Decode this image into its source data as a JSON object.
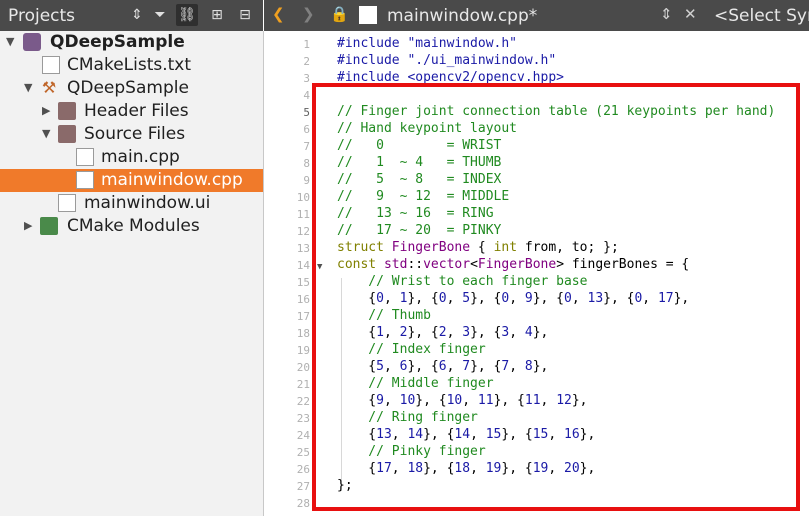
{
  "projects_panel": {
    "title": "Projects",
    "tree": [
      {
        "label": "QDeepSample",
        "icon": "project-icon",
        "bold": true
      },
      {
        "label": "CMakeLists.txt",
        "icon": "cmake-file-icon"
      },
      {
        "label": "QDeepSample",
        "icon": "build-hammer-icon"
      },
      {
        "label": "Header Files",
        "icon": "folder-icon"
      },
      {
        "label": "Source Files",
        "icon": "folder-icon"
      },
      {
        "label": "main.cpp",
        "icon": "cpp-file-icon"
      },
      {
        "label": "mainwindow.cpp",
        "icon": "cpp-file-icon",
        "selected": true
      },
      {
        "label": "mainwindow.ui",
        "icon": "ui-file-icon"
      },
      {
        "label": "CMake Modules",
        "icon": "cmake-folder-icon"
      }
    ]
  },
  "editor": {
    "filename": "mainwindow.cpp*",
    "symbol_selector": "<Select Sym",
    "line_numbers": [
      "1",
      "2",
      "3",
      "4",
      "5",
      "6",
      "7",
      "8",
      "9",
      "10",
      "11",
      "12",
      "13",
      "14",
      "15",
      "16",
      "17",
      "18",
      "19",
      "20",
      "21",
      "22",
      "23",
      "24",
      "25",
      "26",
      "27",
      "28"
    ],
    "current_line": "5"
  },
  "colors": {
    "accent": "#f07a2a",
    "highlight_box": "#e81010",
    "comment": "#208a20",
    "preprocessor": "#1a1aa6"
  }
}
